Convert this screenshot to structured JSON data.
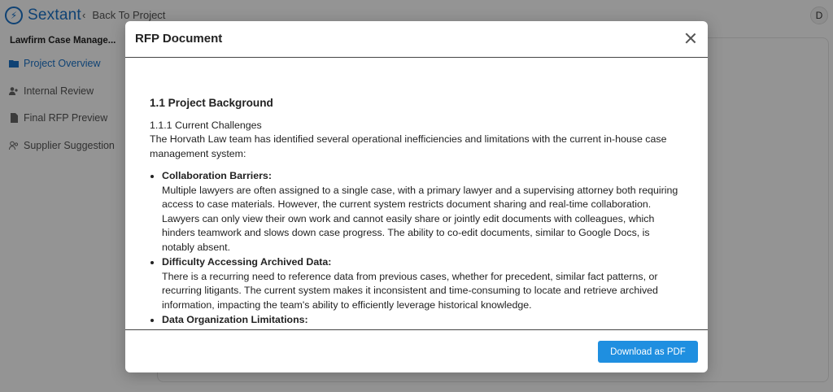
{
  "app": {
    "logo_text": "Sextant",
    "back_label": "Back To Project",
    "avatar_initial": "D"
  },
  "sidebar": {
    "project_title": "Lawfirm Case Manage...",
    "items": [
      {
        "label": "Project Overview",
        "icon": "folder-icon",
        "active": true
      },
      {
        "label": "Internal Review",
        "icon": "users-icon",
        "active": false
      },
      {
        "label": "Final RFP Preview",
        "icon": "document-icon",
        "active": false
      },
      {
        "label": "Supplier Suggestion",
        "icon": "user-group-icon",
        "active": false
      }
    ]
  },
  "modal": {
    "title": "RFP Document",
    "download_label": "Download as PDF",
    "doc": {
      "heading": "1.1 Project Background",
      "subheading": "1.1.1 Current Challenges",
      "intro": "The Horvath Law team has identified several operational inefficiencies and limitations with the current in-house case management system:",
      "items": [
        {
          "title": "Collaboration Barriers:",
          "text": "Multiple lawyers are often assigned to a single case, with a primary lawyer and a supervising attorney both requiring access to case materials. However, the current system restricts document sharing and real-time collaboration. Lawyers can only view their own work and cannot easily share or jointly edit documents with colleagues, which hinders teamwork and slows down case progress. The ability to co-edit documents, similar to Google Docs, is notably absent."
        },
        {
          "title": "Difficulty Accessing Archived Data:",
          "text": "There is a recurring need to reference data from previous cases, whether for precedent, similar fact patterns, or recurring litigants. The current system makes it inconsistent and time-consuming to locate and retrieve archived information, impacting the team's ability to efficiently leverage historical knowledge."
        },
        {
          "title": "Data Organization Limitations:",
          "text": ""
        }
      ]
    }
  },
  "colors": {
    "accent": "#1a73c8",
    "button": "#1f8fe0"
  }
}
